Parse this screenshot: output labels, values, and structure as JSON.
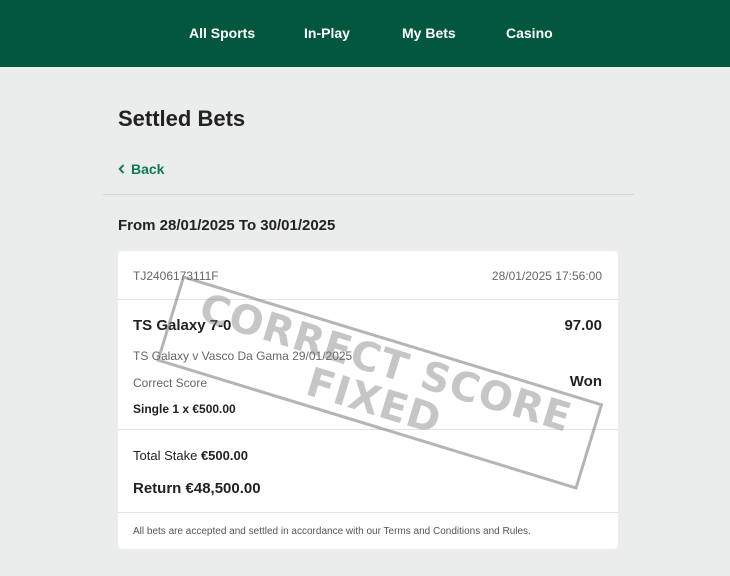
{
  "nav": {
    "items": [
      {
        "label": "All Sports"
      },
      {
        "label": "In-Play"
      },
      {
        "label": "My Bets"
      },
      {
        "label": "Casino"
      }
    ]
  },
  "page": {
    "title": "Settled Bets",
    "back_label": "Back",
    "date_range": "From 28/01/2025 To 30/01/2025"
  },
  "bet": {
    "reference": "TJ2406173111F",
    "placed_at": "28/01/2025 17:56:00",
    "selection": "TS Galaxy 7-0",
    "odds": "97.00",
    "event": "TS Galaxy v Vasco Da Gama 29/01/2025",
    "market": "Correct Score",
    "result": "Won",
    "bet_type": "Single 1 x €500.00",
    "total_stake_label": "Total Stake",
    "total_stake_value": "€500.00",
    "return_label": "Return",
    "return_value": "€48,500.00",
    "disclaimer": "All bets are accepted and settled in accordance with our Terms and Conditions and Rules."
  },
  "stamp": {
    "line1": "CORRECT SCORE",
    "line2": "FIXED"
  },
  "colors": {
    "header_bg": "#03573f",
    "link": "#0d7a55",
    "page_bg": "#ebecec"
  },
  "icons": {
    "back": "chevron-left-icon"
  }
}
